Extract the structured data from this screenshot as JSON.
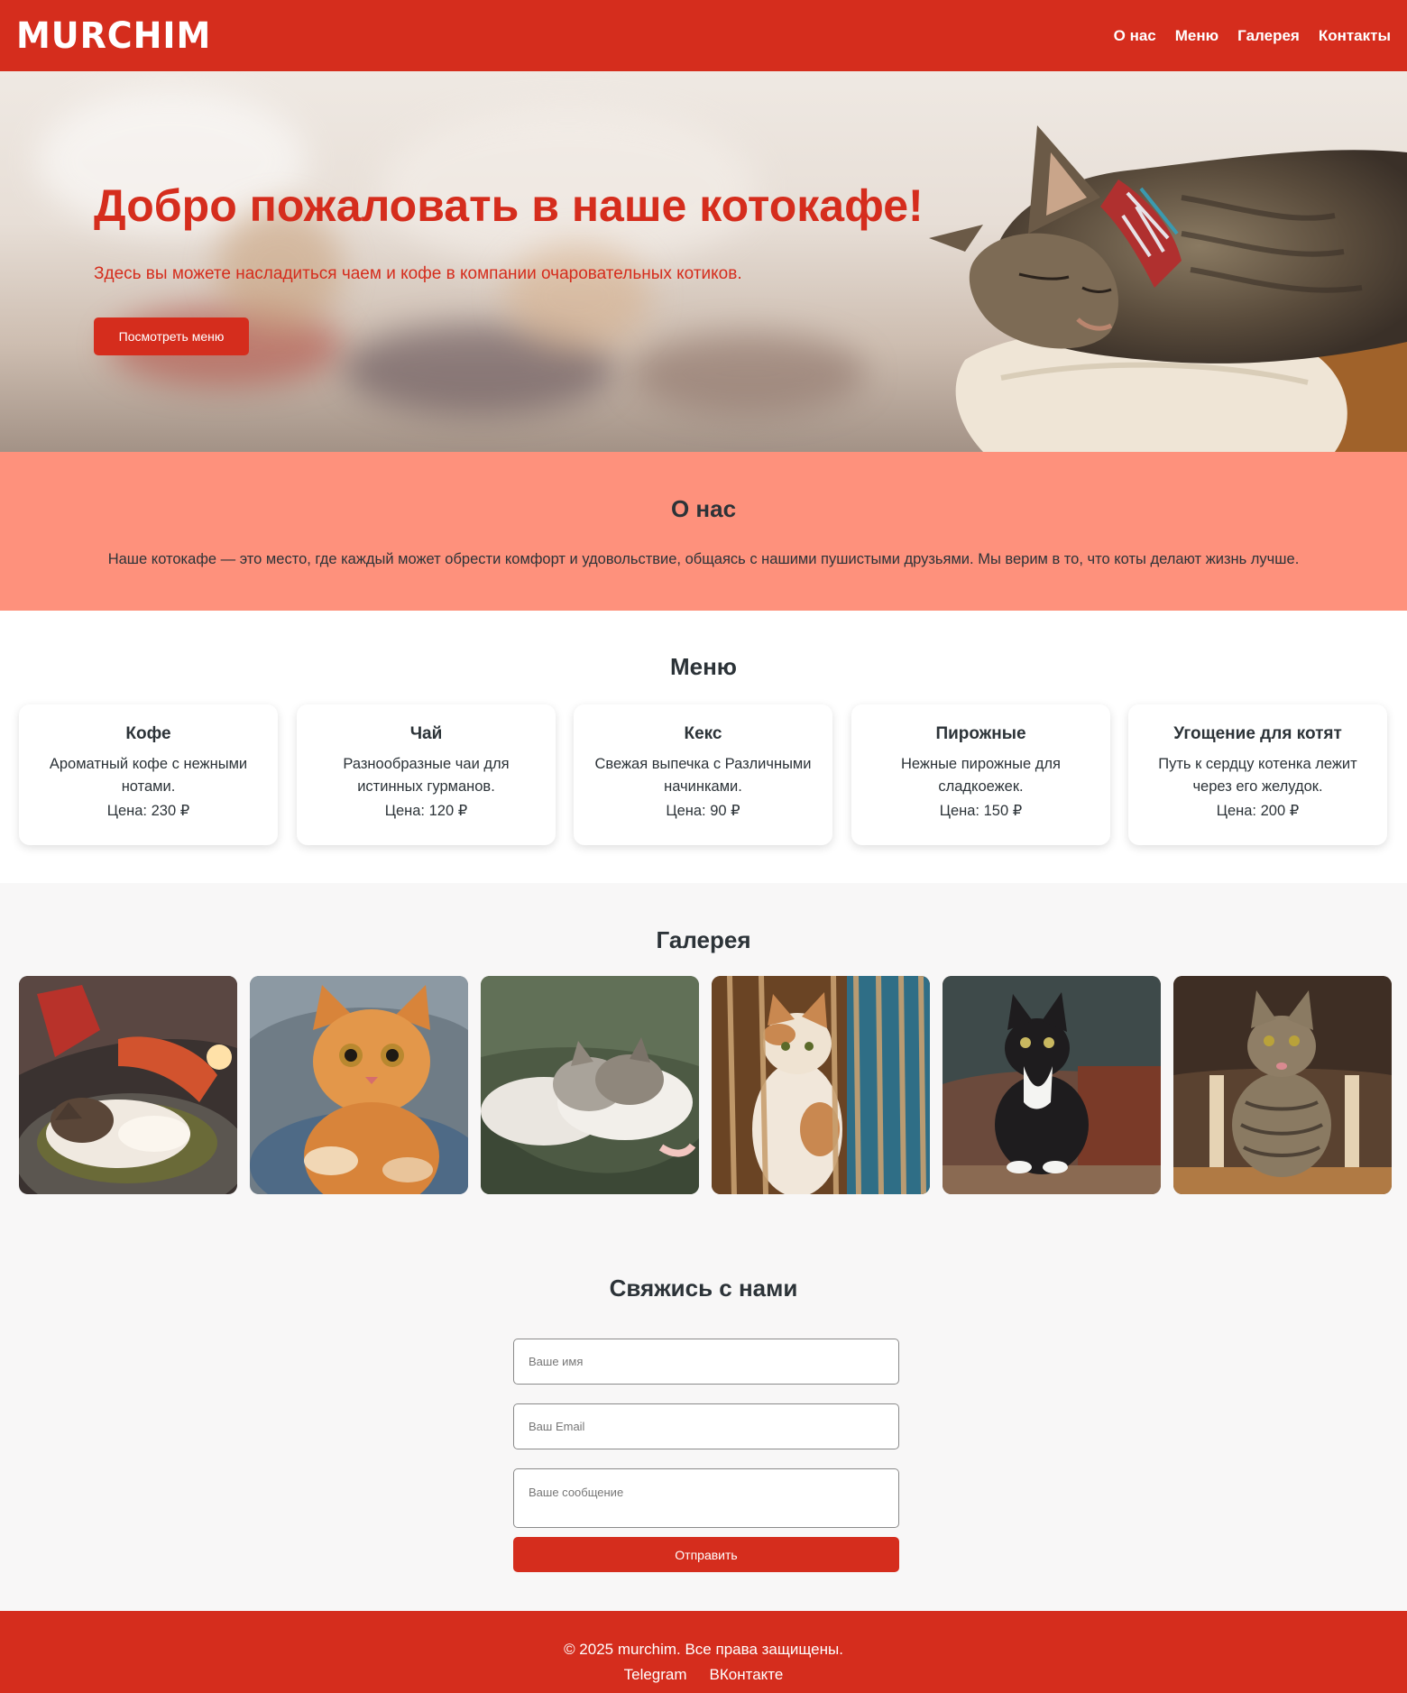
{
  "header": {
    "logo": "MURCHIM",
    "nav": [
      "О нас",
      "Меню",
      "Галерея",
      "Контакты"
    ]
  },
  "hero": {
    "title": "Добро пожаловать в наше котокафе!",
    "subtitle": "Здесь вы можете насладиться чаем и кофе в компании очаровательных котиков.",
    "button": "Посмотреть меню"
  },
  "about": {
    "title": "О нас",
    "text": "Наше котокафе — это место, где каждый может обрести комфорт и удовольствие, общаясь с нашими пушистыми друзьями. Мы верим в то, что коты делают жизнь лучше."
  },
  "menu": {
    "title": "Меню",
    "items": [
      {
        "name": "Кофе",
        "desc": "Ароматный кофе с нежными нотами.",
        "price": "Цена: 230 ₽"
      },
      {
        "name": "Чай",
        "desc": "Разнообразные чаи для истинных гурманов.",
        "price": "Цена: 120 ₽"
      },
      {
        "name": "Кекс",
        "desc": "Свежая выпечка с Различными начинками.",
        "price": "Цена: 90 ₽"
      },
      {
        "name": "Пирожные",
        "desc": "Нежные пирожные для сладкоежек.",
        "price": "Цена: 150 ₽"
      },
      {
        "name": "Угощение для котят",
        "desc": "Путь к сердцу котенка лежит через его желудок.",
        "price": "Цена: 200 ₽"
      }
    ]
  },
  "gallery": {
    "title": "Галерея"
  },
  "contact": {
    "title": "Свяжись с нами",
    "name_placeholder": "Ваше имя",
    "email_placeholder": "Ваш Email",
    "message_placeholder": "Ваше сообщение",
    "submit": "Отправить"
  },
  "footer": {
    "copyright": "© 2025 murchim. Все права защищены.",
    "links": [
      "Telegram",
      "ВКонтакте"
    ]
  },
  "colors": {
    "brand_red": "#d52d1d",
    "about_bg": "#fe917c",
    "section_bg": "#f8f7f7",
    "text_dark": "#2c3338"
  }
}
